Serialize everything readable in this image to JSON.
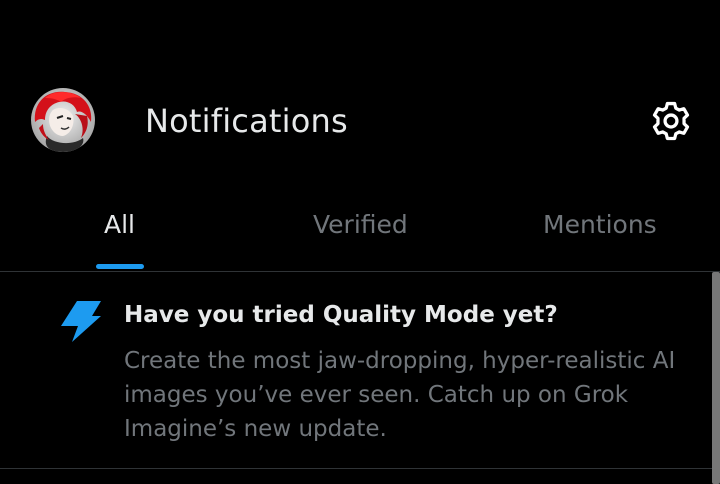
{
  "header": {
    "title": "Notifications",
    "avatar_icon": "profile-avatar",
    "settings_icon": "gear-icon"
  },
  "tabs": [
    {
      "label": "All",
      "active": true
    },
    {
      "label": "Verified",
      "active": false
    },
    {
      "label": "Mentions",
      "active": false
    }
  ],
  "notifications": [
    {
      "icon": "lightning-bolt-icon",
      "title": "Have you tried Quality Mode yet?",
      "body": "Create the most jaw-dropping, hyper-realistic AI images you’ve ever seen. Catch up on Grok Imagine’s new update."
    }
  ],
  "colors": {
    "background": "#000000",
    "text_primary": "#e7e9ea",
    "text_secondary": "#71767b",
    "accent": "#1d9bf0",
    "divider": "#2f3336"
  }
}
